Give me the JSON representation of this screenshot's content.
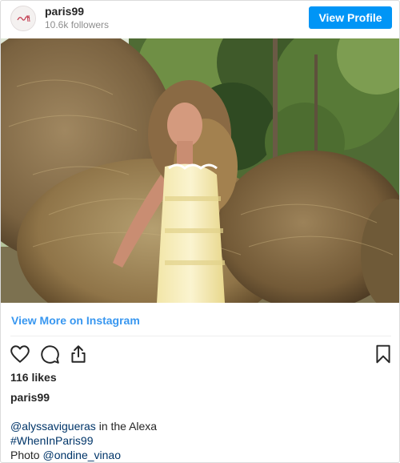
{
  "profile": {
    "username": "paris99",
    "followers": "10.6k followers",
    "view_profile_label": "View Profile",
    "avatar_text": "paris 99"
  },
  "post": {
    "view_more_label": "View More on Instagram",
    "likes": "116 likes",
    "caption_username": "paris99",
    "caption_line1_mention": "@alyssavigueras",
    "caption_line1_text": " in the Alexa",
    "caption_line2_hashtag": "#WhenInParis99",
    "caption_line3_text": "Photo ",
    "caption_line3_mention": "@ondine_vinao"
  },
  "icons": {
    "like": "heart-icon",
    "comment": "comment-icon",
    "share": "share-icon",
    "save": "bookmark-icon"
  },
  "colors": {
    "accent": "#0095f6",
    "link": "#3897f0",
    "caption_link": "#003569"
  }
}
